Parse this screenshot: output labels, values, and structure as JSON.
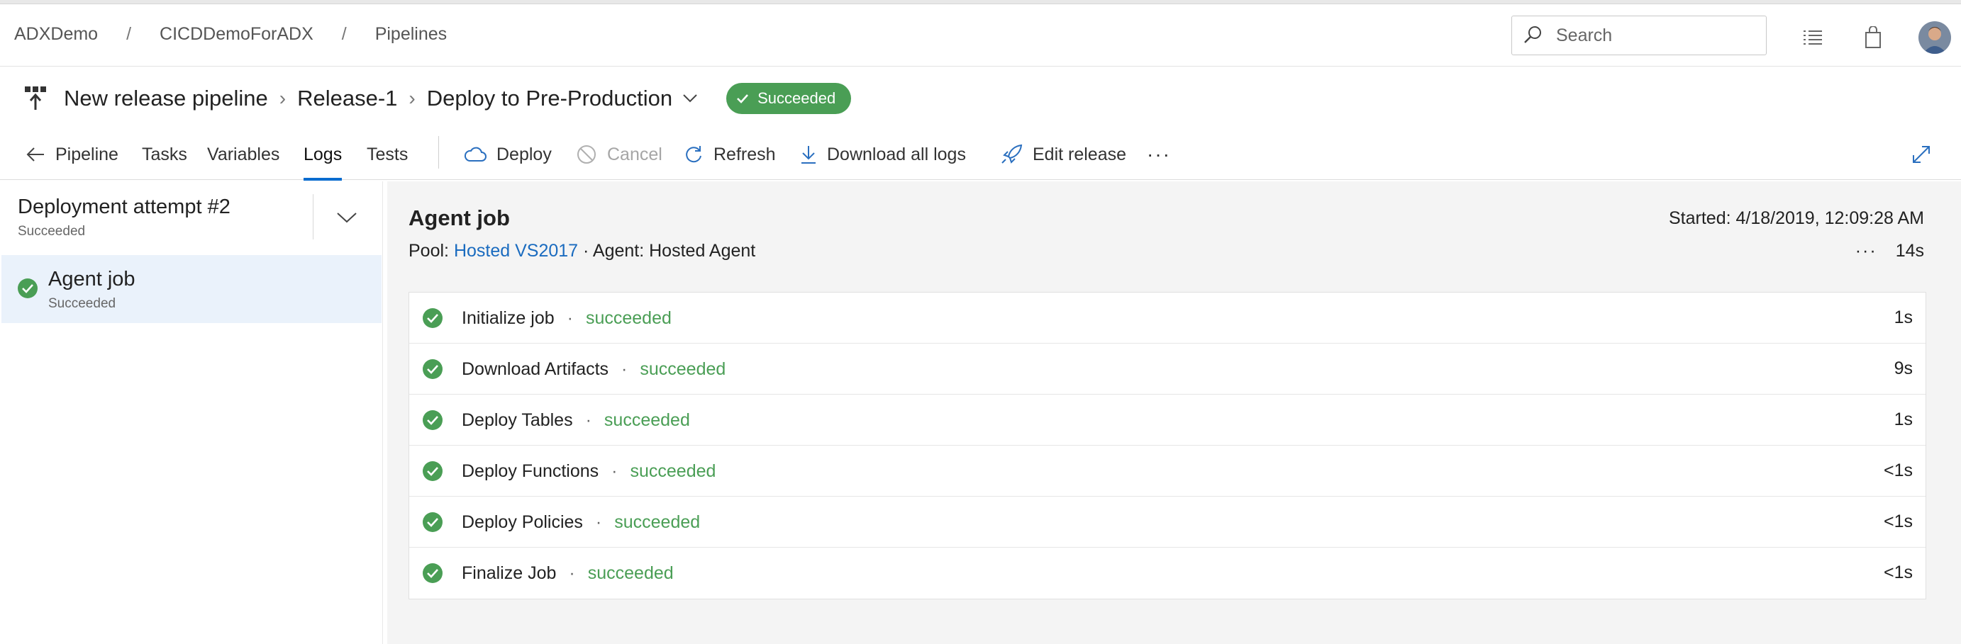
{
  "breadcrumb": [
    "ADXDemo",
    "CICDDemoForADX",
    "Pipelines"
  ],
  "search": {
    "placeholder": "Search"
  },
  "header_icons": [
    "list-icon",
    "shopping-bag-icon",
    "avatar"
  ],
  "title": {
    "pipeline": "New release pipeline",
    "release": "Release-1",
    "stage": "Deploy to Pre-Production",
    "status": "Succeeded"
  },
  "toolbar": {
    "back": "Pipeline",
    "tabs": [
      "Tasks",
      "Variables",
      "Logs",
      "Tests"
    ],
    "active_tab": "Logs",
    "actions": {
      "deploy": "Deploy",
      "cancel": "Cancel",
      "refresh": "Refresh",
      "download": "Download all logs",
      "edit": "Edit release",
      "more": "···"
    }
  },
  "left": {
    "attempt_title": "Deployment attempt #2",
    "attempt_status": "Succeeded",
    "job_name": "Agent job",
    "job_status": "Succeeded"
  },
  "main": {
    "title": "Agent job",
    "started": "Started: 4/18/2019, 12:09:28 AM",
    "pool_label": "Pool:",
    "pool_link": "Hosted VS2017",
    "agent": "· Agent: Hosted Agent",
    "more": "···",
    "total_duration": "14s",
    "steps": [
      {
        "name": "Initialize job",
        "state": "succeeded",
        "duration": "1s"
      },
      {
        "name": "Download Artifacts",
        "state": "succeeded",
        "duration": "9s"
      },
      {
        "name": "Deploy Tables",
        "state": "succeeded",
        "duration": "1s"
      },
      {
        "name": "Deploy Functions",
        "state": "succeeded",
        "duration": "<1s"
      },
      {
        "name": "Deploy Policies",
        "state": "succeeded",
        "duration": "<1s"
      },
      {
        "name": "Finalize Job",
        "state": "succeeded",
        "duration": "<1s"
      }
    ]
  },
  "colors": {
    "success": "#4a9e55",
    "link": "#1a6bbf",
    "accent": "#0a6ccf"
  }
}
